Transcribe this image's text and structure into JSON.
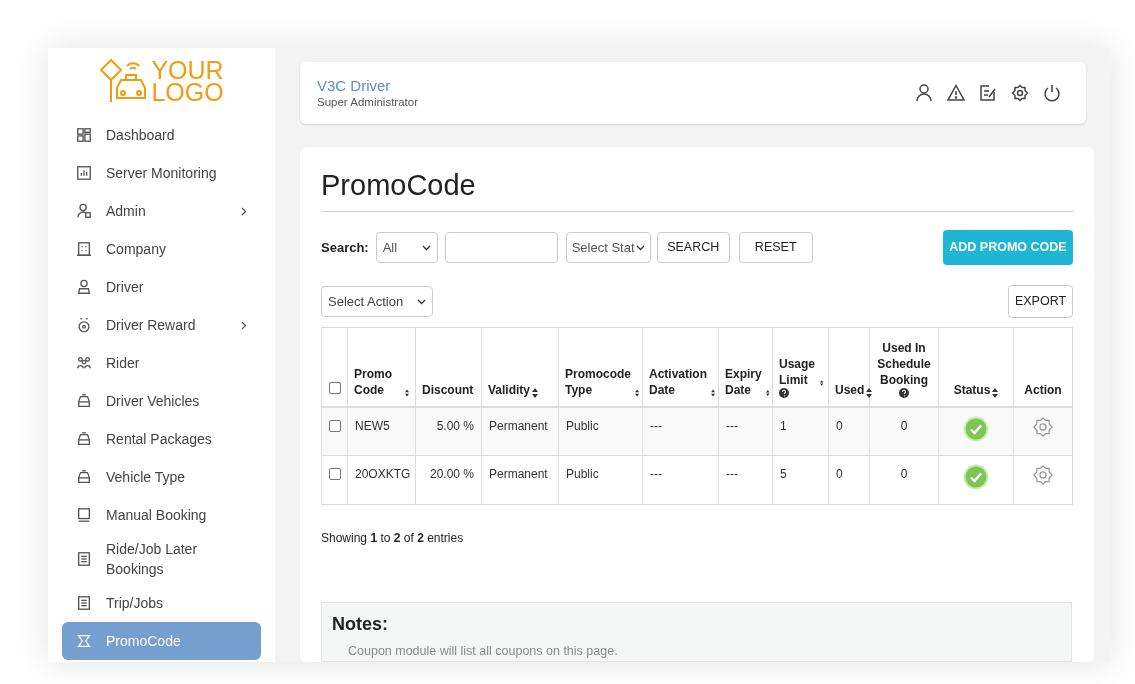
{
  "logo": {
    "line_1": "YOUR",
    "line_2": "LOGO"
  },
  "sidebar": {
    "items": [
      {
        "label": "Dashboard",
        "has_submenu": false,
        "selected": false
      },
      {
        "label": "Server Monitoring",
        "has_submenu": false,
        "selected": false
      },
      {
        "label": "Admin",
        "has_submenu": true,
        "selected": false
      },
      {
        "label": "Company",
        "has_submenu": false,
        "selected": false
      },
      {
        "label": "Driver",
        "has_submenu": false,
        "selected": false
      },
      {
        "label": "Driver Reward",
        "has_submenu": true,
        "selected": false
      },
      {
        "label": "Rider",
        "has_submenu": false,
        "selected": false
      },
      {
        "label": "Driver Vehicles",
        "has_submenu": false,
        "selected": false
      },
      {
        "label": "Rental Packages",
        "has_submenu": false,
        "selected": false
      },
      {
        "label": "Vehicle Type",
        "has_submenu": false,
        "selected": false
      },
      {
        "label": "Manual Booking",
        "has_submenu": false,
        "selected": false
      },
      {
        "label": "Ride/Job Later Bookings",
        "has_submenu": false,
        "selected": false
      },
      {
        "label": "Trip/Jobs",
        "has_submenu": false,
        "selected": false
      },
      {
        "label": "PromoCode",
        "has_submenu": false,
        "selected": true
      }
    ]
  },
  "header": {
    "user_name": "V3C Driver",
    "role": "Super Administrator"
  },
  "page_title": "PromoCode",
  "search": {
    "label": "Search:",
    "field_select": "All",
    "status_select": "Select Stat",
    "search_button": "SEARCH",
    "reset_button": "RESET",
    "add_button": "ADD PROMO CODE"
  },
  "bulk_action": {
    "select": "Select Action",
    "export_button": "EXPORT"
  },
  "table": {
    "select_all_checked": false,
    "columns": [
      {
        "label": "Promo Code",
        "sortable": true,
        "help": false
      },
      {
        "label": "Discount",
        "sortable": false,
        "help": false
      },
      {
        "label": "Validity",
        "sortable": true,
        "help": false
      },
      {
        "label": "Promocode Type",
        "sortable": true,
        "help": false
      },
      {
        "label": "Activation Date",
        "sortable": true,
        "help": false
      },
      {
        "label": "Expiry Date",
        "sortable": true,
        "help": false
      },
      {
        "label": "Usage Limit",
        "sortable": true,
        "help": true
      },
      {
        "label": "Used",
        "sortable": true,
        "help": false
      },
      {
        "label": "Used In Schedule Booking",
        "sortable": false,
        "help": true
      },
      {
        "label": "Status",
        "sortable": true,
        "help": false
      },
      {
        "label": "Action",
        "sortable": false,
        "help": false
      }
    ],
    "rows": [
      {
        "checked": false,
        "cells": [
          "NEW5",
          "5.00 %",
          "Permanent",
          "Public",
          "---",
          "---",
          "1",
          "0",
          "0"
        ],
        "active": true
      },
      {
        "checked": false,
        "cells": [
          "20OXKTG",
          "20.00 %",
          "Permanent",
          "Public",
          "---",
          "---",
          "5",
          "0",
          "0"
        ],
        "active": true
      }
    ]
  },
  "entries_info": "Showing **1** to **2** of **2** entries",
  "notes": {
    "title": "Notes:",
    "items": [
      "Coupon module will list all coupons on this page."
    ]
  }
}
